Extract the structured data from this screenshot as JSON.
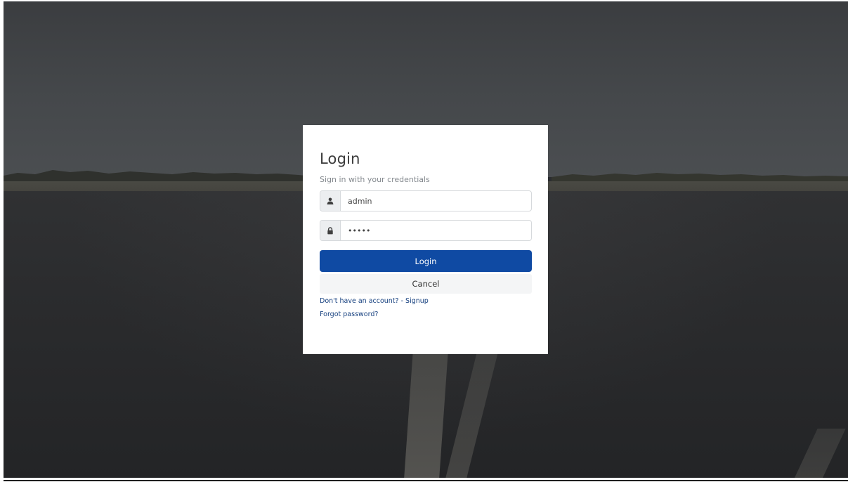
{
  "login_card": {
    "title": "Login",
    "subtitle": "Sign in with your credentials",
    "username": {
      "icon": "user-icon",
      "value": "admin"
    },
    "password": {
      "icon": "lock-icon",
      "value": "•••••"
    },
    "login_button_label": "Login",
    "cancel_button_label": "Cancel",
    "signup_link": "Don't have an account? - Signup",
    "forgot_link": "Forgot password?"
  },
  "colors": {
    "primary": "#0f4aa3",
    "link": "#16407f",
    "cancel_bg": "#f4f5f6",
    "addon_bg": "#eceef0"
  }
}
